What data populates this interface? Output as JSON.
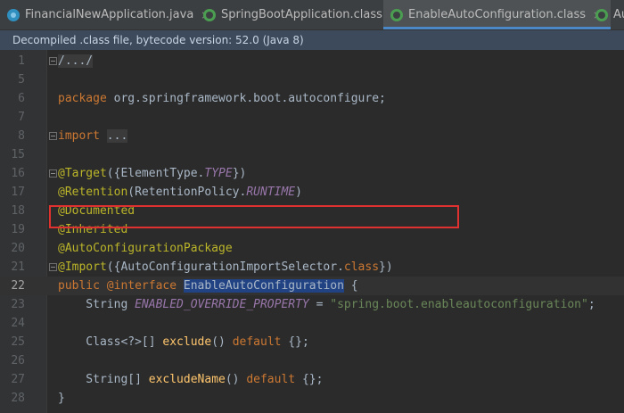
{
  "tabs": [
    {
      "label": "FinancialNewApplication.java",
      "icon": "java-file-icon",
      "close": "×"
    },
    {
      "label": "SpringBootApplication.class",
      "icon": "class-file-icon",
      "close": "×"
    },
    {
      "label": "EnableAutoConfiguration.class",
      "icon": "class-file-icon",
      "close": "×"
    },
    {
      "label": "Au",
      "icon": "class-file-icon"
    }
  ],
  "infobar": "Decompiled .class file, bytecode version: 52.0 (Java 8)",
  "lines": [
    {
      "n": "1",
      "fold": true,
      "html_parts": [
        {
          "t": "/.../",
          "c": "folded"
        }
      ]
    },
    {
      "n": "5",
      "html_parts": []
    },
    {
      "n": "6",
      "html_parts": [
        {
          "t": "package",
          "c": "kw"
        },
        {
          "t": " org.springframework.boot.autoconfigure;",
          "c": ""
        }
      ]
    },
    {
      "n": "7",
      "html_parts": []
    },
    {
      "n": "8",
      "fold": true,
      "html_parts": [
        {
          "t": "import",
          "c": "kw"
        },
        {
          "t": " ",
          "c": ""
        },
        {
          "t": "...",
          "c": "folded"
        }
      ]
    },
    {
      "n": "15",
      "html_parts": []
    },
    {
      "n": "16",
      "fold": true,
      "html_parts": [
        {
          "t": "@Target",
          "c": "ann"
        },
        {
          "t": "({ElementType.",
          "c": ""
        },
        {
          "t": "TYPE",
          "c": "fld"
        },
        {
          "t": "})",
          "c": ""
        }
      ]
    },
    {
      "n": "17",
      "html_parts": [
        {
          "t": "@Retention",
          "c": "ann"
        },
        {
          "t": "(RetentionPolicy.",
          "c": ""
        },
        {
          "t": "RUNTIME",
          "c": "fld"
        },
        {
          "t": ")",
          "c": ""
        }
      ]
    },
    {
      "n": "18",
      "html_parts": [
        {
          "t": "@Documented",
          "c": "ann"
        }
      ]
    },
    {
      "n": "19",
      "html_parts": [
        {
          "t": "@Inherited",
          "c": "ann"
        }
      ]
    },
    {
      "n": "20",
      "html_parts": [
        {
          "t": "@AutoConfigurationPackage",
          "c": "ann"
        }
      ]
    },
    {
      "n": "21",
      "fold": true,
      "html_parts": [
        {
          "t": "@Import",
          "c": "ann"
        },
        {
          "t": "({AutoConfigurationImportSelector.",
          "c": ""
        },
        {
          "t": "class",
          "c": "kw"
        },
        {
          "t": "})",
          "c": ""
        }
      ]
    },
    {
      "n": "22",
      "current": true,
      "html_parts": [
        {
          "t": "public",
          "c": "kw"
        },
        {
          "t": " ",
          "c": ""
        },
        {
          "t": "@interface",
          "c": "kw"
        },
        {
          "t": " ",
          "c": ""
        },
        {
          "t": "EnableAutoConfiguration",
          "c": "hl"
        },
        {
          "t": " {",
          "c": ""
        }
      ]
    },
    {
      "n": "23",
      "html_parts": [
        {
          "t": "    String ",
          "c": ""
        },
        {
          "t": "ENABLED_OVERRIDE_PROPERTY",
          "c": "fld"
        },
        {
          "t": " = ",
          "c": ""
        },
        {
          "t": "\"spring.boot.enableautoconfiguration\"",
          "c": "str"
        },
        {
          "t": ";",
          "c": ""
        }
      ]
    },
    {
      "n": "24",
      "html_parts": []
    },
    {
      "n": "25",
      "html_parts": [
        {
          "t": "    Class<?>[] ",
          "c": ""
        },
        {
          "t": "exclude",
          "c": "fn"
        },
        {
          "t": "() ",
          "c": ""
        },
        {
          "t": "default",
          "c": "kw"
        },
        {
          "t": " {};",
          "c": ""
        }
      ]
    },
    {
      "n": "26",
      "html_parts": []
    },
    {
      "n": "27",
      "html_parts": [
        {
          "t": "    String[] ",
          "c": ""
        },
        {
          "t": "excludeName",
          "c": "fn"
        },
        {
          "t": "() ",
          "c": ""
        },
        {
          "t": "default",
          "c": "kw"
        },
        {
          "t": " {};",
          "c": ""
        }
      ]
    },
    {
      "n": "28",
      "html_parts": [
        {
          "t": "}",
          "c": ""
        }
      ]
    }
  ]
}
